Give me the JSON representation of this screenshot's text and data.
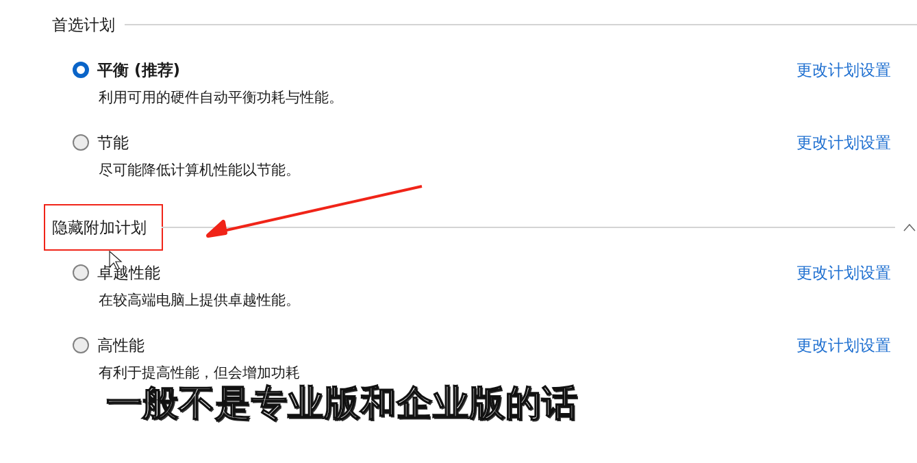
{
  "sections": [
    {
      "title": "首选计划",
      "collapsible": false,
      "highlighted": false,
      "plans": [
        {
          "name": "平衡 (推荐)",
          "description": "利用可用的硬件自动平衡功耗与性能。",
          "selected": true,
          "link": "更改计划设置"
        },
        {
          "name": "节能",
          "description": "尽可能降低计算机性能以节能。",
          "selected": false,
          "link": "更改计划设置"
        }
      ]
    },
    {
      "title": "隐藏附加计划",
      "collapsible": true,
      "highlighted": true,
      "plans": [
        {
          "name": "卓越性能",
          "description": "在较高端电脑上提供卓越性能。",
          "selected": false,
          "link": "更改计划设置"
        },
        {
          "name": "高性能",
          "description": "有利于提高性能，但会增加功耗",
          "selected": false,
          "link": "更改计划设置"
        }
      ]
    }
  ],
  "subtitle": "一般不是专业版和企业版的话"
}
